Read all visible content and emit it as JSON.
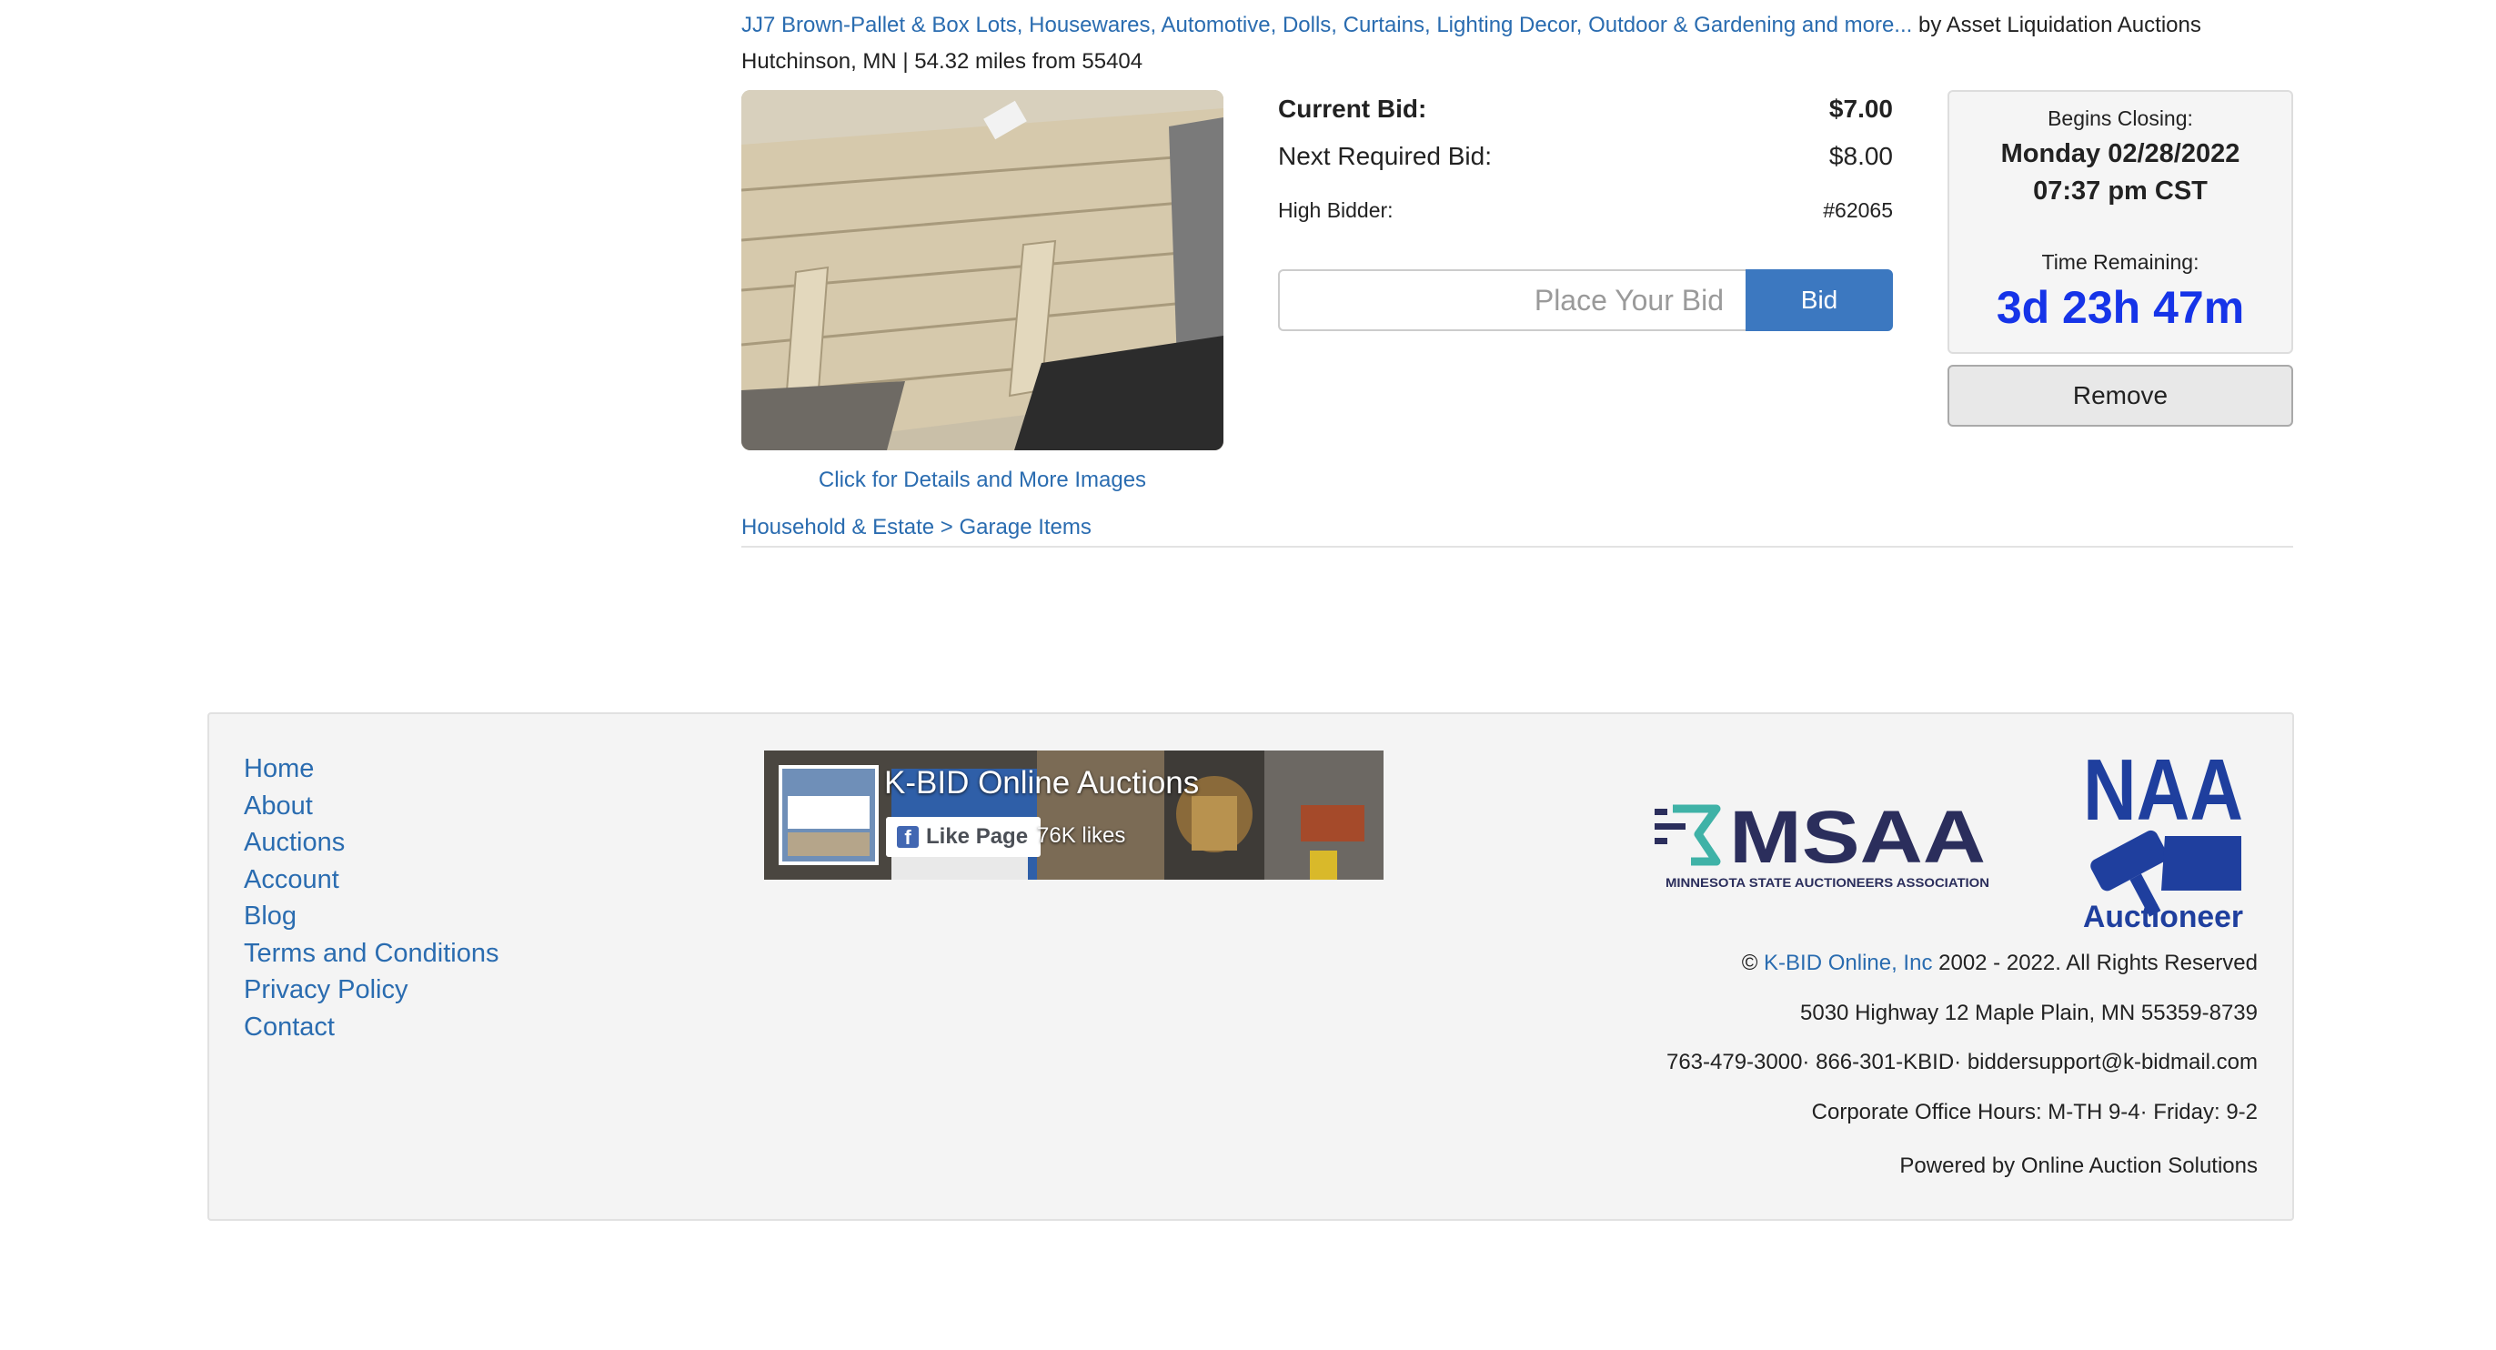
{
  "lot": {
    "title_link": "JJ7 Brown-Pallet & Box Lots, Housewares, Automotive, Dolls, Curtains, Lighting Decor, Outdoor & Gardening and more...",
    "by_text": " by Asset Liquidation Auctions",
    "location": "Hutchinson, MN | 54.32 miles from 55404",
    "details_link": "Click for Details and More Images",
    "category_link": "Household & Estate > Garage Items",
    "current_bid_label": "Current Bid:",
    "current_bid_value": "$7.00",
    "next_bid_label": "Next Required Bid:",
    "next_bid_value": "$8.00",
    "high_bidder_label": "High Bidder:",
    "high_bidder_value": "#62065",
    "bid_placeholder": "Place Your Bid",
    "bid_button": "Bid",
    "closing_label": "Begins Closing:",
    "closing_date": "Monday 02/28/2022",
    "closing_time": "07:37 pm CST",
    "remaining_label": "Time Remaining:",
    "remaining_value": "3d 23h 47m",
    "remove_button": "Remove"
  },
  "footer": {
    "nav": [
      "Home",
      "About",
      "Auctions",
      "Account",
      "Blog",
      "Terms and Conditions",
      "Privacy Policy",
      "Contact"
    ],
    "facebook": {
      "page_title": "K-BID Online Auctions",
      "like_label": "Like Page",
      "likes": "76K likes",
      "thumb_text": "K-BID"
    },
    "msaa": {
      "name": "MSAA",
      "full": "MINNESOTA STATE AUCTIONEERS ASSOCIATION"
    },
    "naa": {
      "top": "NAA",
      "bottom": "Auctioneer"
    },
    "copyright_prefix": "© ",
    "company_link": "K-BID Online, Inc",
    "copyright_suffix": " 2002 - 2022. All Rights Reserved",
    "address": "5030 Highway 12 Maple Plain, MN 55359-8739",
    "phones": "763-479-3000· 866-301-KBID· biddersupport@k-bidmail.com",
    "hours": "Corporate Office Hours: M-TH 9-4· Friday: 9-2",
    "powered_by": "Powered by Online Auction Solutions"
  },
  "colors": {
    "link": "#2a6cb0",
    "bid_button": "#3c78c0",
    "time_remaining": "#1634e8",
    "msaa_navy": "#2b2e5c",
    "msaa_teal": "#3fb2a7",
    "naa_blue": "#1f3f9e"
  }
}
